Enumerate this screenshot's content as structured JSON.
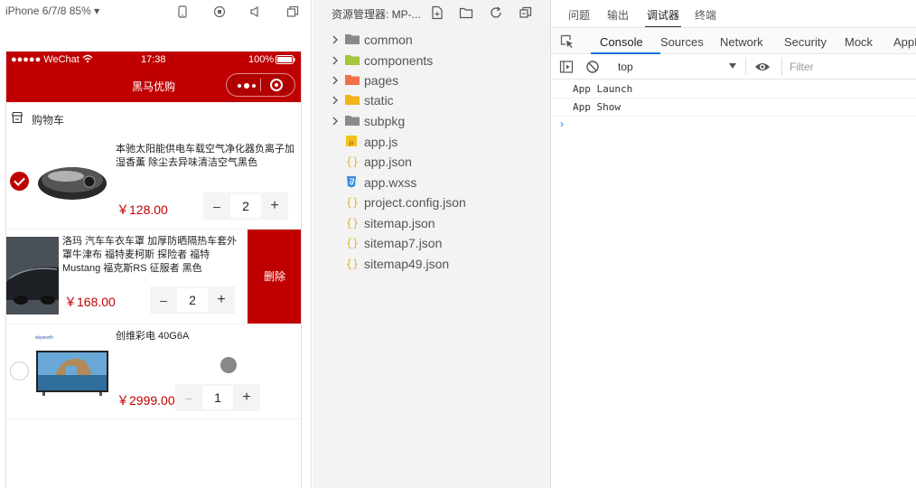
{
  "simulator": {
    "device": "iPhone 6/7/8 85% ▾",
    "status": {
      "carrier": "●●●●● WeChat",
      "time": "17:38",
      "battery": "100%"
    },
    "nav_title": "黑马优购",
    "cart_header": "购物车",
    "items": [
      {
        "name": "本驰太阳能供电车载空气净化器负离子加湿香薰 除尘去异味清洁空气黑色",
        "price": "￥128.00",
        "count": "2",
        "checked": true
      },
      {
        "name": "洛玛 汽车车衣车罩 加厚防晒隔热车套外罩牛津布 福特麦柯斯 探险者 福特Mustang 福克斯RS 征服者 黑色",
        "price": "￥168.00",
        "count": "2"
      },
      {
        "name": "创维彩电 40G6A",
        "price": "￥2999.00",
        "count": "1",
        "checked": false,
        "brand": "skyworth"
      }
    ],
    "delete_label": "删除"
  },
  "explorer": {
    "title": "资源管理器: MP-...",
    "tree": [
      {
        "label": "common",
        "type": "folder",
        "color": "#8a8a8a"
      },
      {
        "label": "components",
        "type": "folder",
        "color": "#a2c63c"
      },
      {
        "label": "pages",
        "type": "folder",
        "color": "#f0704a"
      },
      {
        "label": "static",
        "type": "folder",
        "color": "#f2b41c"
      },
      {
        "label": "subpkg",
        "type": "folder",
        "color": "#8a8a8a"
      },
      {
        "label": "app.js",
        "type": "js",
        "color": "#f2c21c"
      },
      {
        "label": "app.json",
        "type": "json",
        "color": "#f2b41c"
      },
      {
        "label": "app.wxss",
        "type": "css",
        "color": "#3b8de0"
      },
      {
        "label": "project.config.json",
        "type": "json",
        "color": "#f2b41c"
      },
      {
        "label": "sitemap.json",
        "type": "json",
        "color": "#f2b41c"
      },
      {
        "label": "sitemap7.json",
        "type": "json",
        "color": "#f2b41c"
      },
      {
        "label": "sitemap49.json",
        "type": "json",
        "color": "#f2b41c"
      }
    ]
  },
  "devtools": {
    "top_tabs": [
      "问题",
      "输出",
      "调试器",
      "终端"
    ],
    "sub_tabs": [
      "Console",
      "Sources",
      "Network",
      "Security",
      "Mock",
      "AppD"
    ],
    "context": "top",
    "filter_placeholder": "Filter",
    "logs": [
      "App Launch",
      "App Show"
    ],
    "prompt": "›"
  },
  "colors": {
    "brand": "#c00000",
    "link": "#1a73e8"
  }
}
